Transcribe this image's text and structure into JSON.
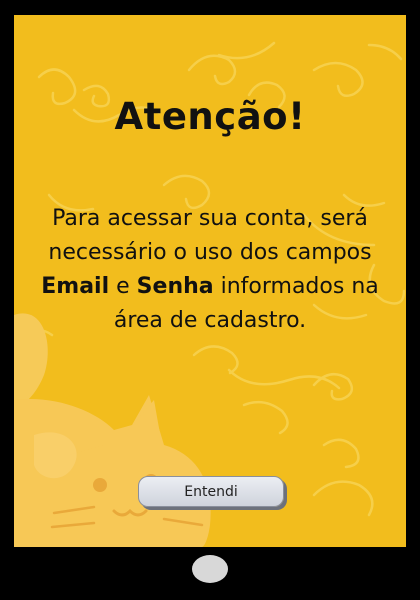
{
  "dialog": {
    "title": "Atenção!",
    "message_part1": "Para acessar sua conta, será necessário o uso dos campos ",
    "field_email": "Email",
    "message_part2": " e ",
    "field_password": "Senha",
    "message_part3": " informados na área de cadastro.",
    "button_label": "Entendi"
  },
  "colors": {
    "screen_background": "#f2bd1d",
    "device_frame": "#000000",
    "text": "#111111",
    "button": "#d9dce3",
    "home_button": "#d8d8d8"
  },
  "icons": {
    "background_illustration": "cat-icon",
    "background_pattern": "swirl-pattern"
  }
}
